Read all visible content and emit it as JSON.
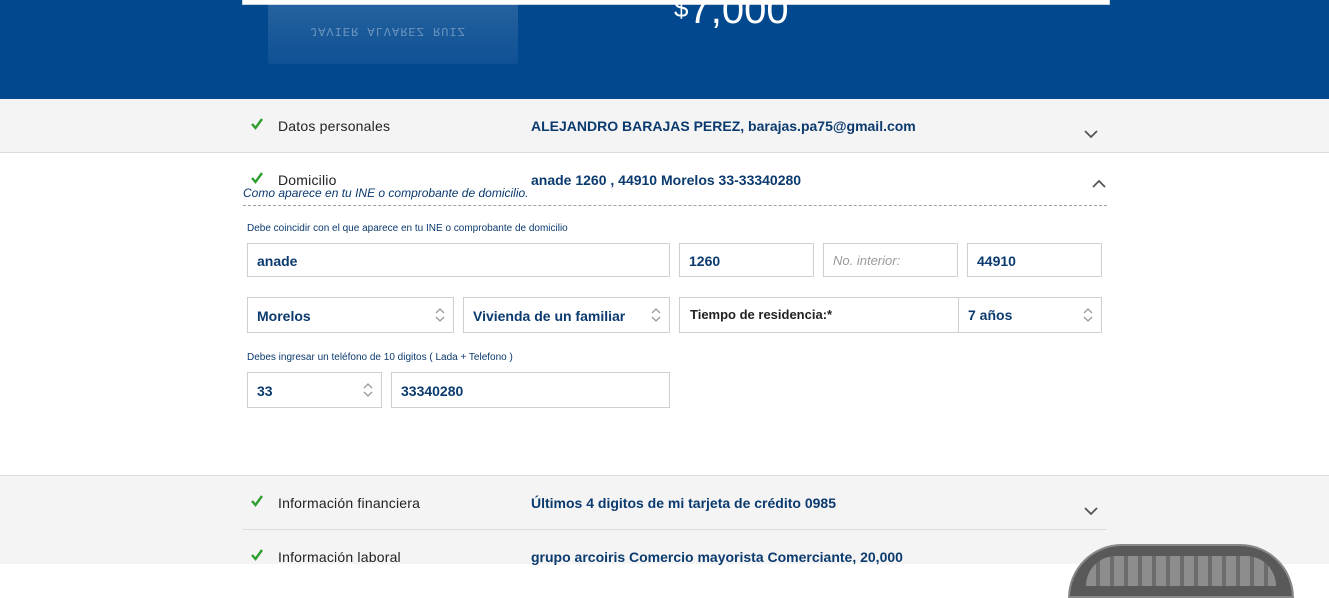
{
  "banner": {
    "currency": "$",
    "amount": "7,000",
    "watermark_text": "JAVIER ALVAREZ RUIZ"
  },
  "sections": {
    "personal": {
      "title": "Datos personales",
      "summary": "ALEJANDRO BARAJAS PEREZ, barajas.pa75@gmail.com",
      "state": "collapsed"
    },
    "address": {
      "title": "Domicilio",
      "summary": "anade 1260 , 44910 Morelos 33-33340280",
      "hint": "Como aparece en tu INE o comprobante de domicilio.",
      "state": "expanded"
    },
    "financial": {
      "title": "Información financiera",
      "summary": "Últimos 4 digitos de mi tarjeta de crédito 0985",
      "state": "collapsed"
    },
    "work": {
      "title": "Información laboral",
      "summary": "grupo arcoiris Comercio mayorista Comerciante, 20,000",
      "state": "collapsed"
    }
  },
  "address_form": {
    "street_note": "Debe coincidir con el que aparece en tu INE o comprobante de domicilio",
    "street": "anade",
    "ext_number": "1260",
    "int_number_placeholder": "No. interior:",
    "postal_code": "44910",
    "state_select": "Morelos",
    "housing_select": "Vivienda de un familiar",
    "residence_label": "Tiempo de residencia:*",
    "residence_select": "7 años",
    "phone_note": "Debes ingresar un teléfono de 10 digitos ( Lada + Telefono )",
    "area_code_select": "33",
    "phone": "33340280"
  },
  "colors": {
    "banner": "#02488f",
    "accent_text": "#0b3a6e",
    "check": "#2e9e2e"
  },
  "icons": [
    "check-icon",
    "chevron-down-icon",
    "chevron-up-icon",
    "select-arrows-icon"
  ]
}
